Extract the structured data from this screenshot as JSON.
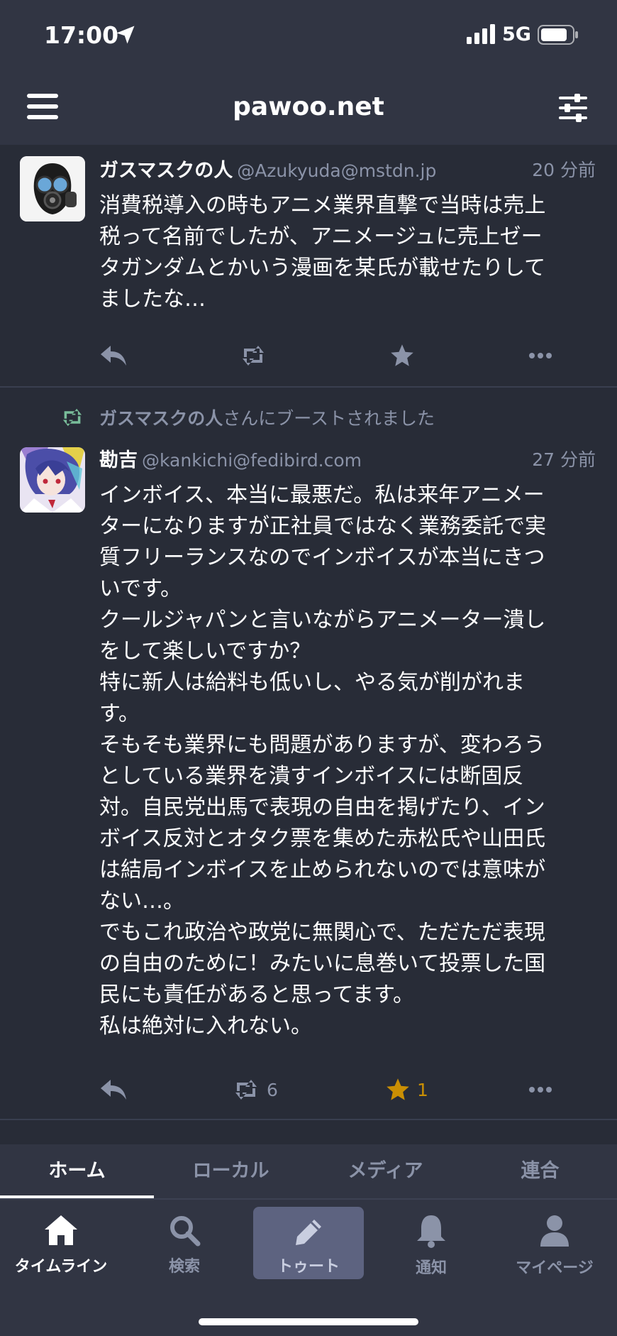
{
  "status_bar": {
    "time": "17:00",
    "network": "5G"
  },
  "header": {
    "title": "pawoo.net"
  },
  "posts": [
    {
      "display_name": "ガスマスクの人",
      "account": "@Azukyuda@mstdn.jp",
      "time": "20 分前",
      "content_lines": [
        "消費税導入の時もアニメ業界直撃で当時は売上",
        "税って名前でしたが、アニメージュに売上ゼー",
        "タガンダムとかいう漫画を某氏が載せたりして",
        "ましたな…"
      ],
      "actions": {
        "reply_icon": "reply-icon",
        "boost_icon": "boost-icon",
        "fav_icon": "star-icon",
        "more_icon": "more-icon"
      }
    },
    {
      "boosted_by_name": "ガスマスクの人",
      "boosted_suffix": "さんにブーストされました",
      "display_name": "勘吉",
      "account": "@kankichi@fedibird.com",
      "time": "27 分前",
      "content_lines": [
        "インボイス、本当に最悪だ。私は来年アニメー",
        "ターになりますが正社員ではなく業務委託で実",
        "質フリーランスなのでインボイスが本当にきつ",
        "いです。",
        "クールジャパンと言いながらアニメーター潰し",
        "をして楽しいですか？",
        "特に新人は給料も低いし、やる気が削がれま",
        "す。",
        "そもそも業界にも問題がありますが、変わろう",
        "としている業界を潰すインボイスには断固反",
        "対。自民党出馬で表現の自由を掲げたり、イン",
        "ボイス反対とオタク票を集めた赤松氏や山田氏",
        "は結局インボイスを止められないのでは意味が",
        "ない…。",
        "でもこれ政治や政党に無関心で、ただただ表現",
        "の自由のために！みたいに息巻いて投票した国",
        "民にも責任があると思ってます。",
        "私は絶対に入れない。"
      ],
      "boost_count": "6",
      "fav_count": "1"
    }
  ],
  "tabs": [
    "ホーム",
    "ローカル",
    "メディア",
    "連合"
  ],
  "bottom_nav": {
    "timeline": "タイムライン",
    "search": "検索",
    "toot": "トゥート",
    "notifications": "通知",
    "mypage": "マイページ"
  },
  "colors": {
    "background": "#282c37",
    "bar": "#313543",
    "muted": "#8b93a8",
    "boost_green": "#79bd9a",
    "fav_gold": "#ca8f04"
  }
}
